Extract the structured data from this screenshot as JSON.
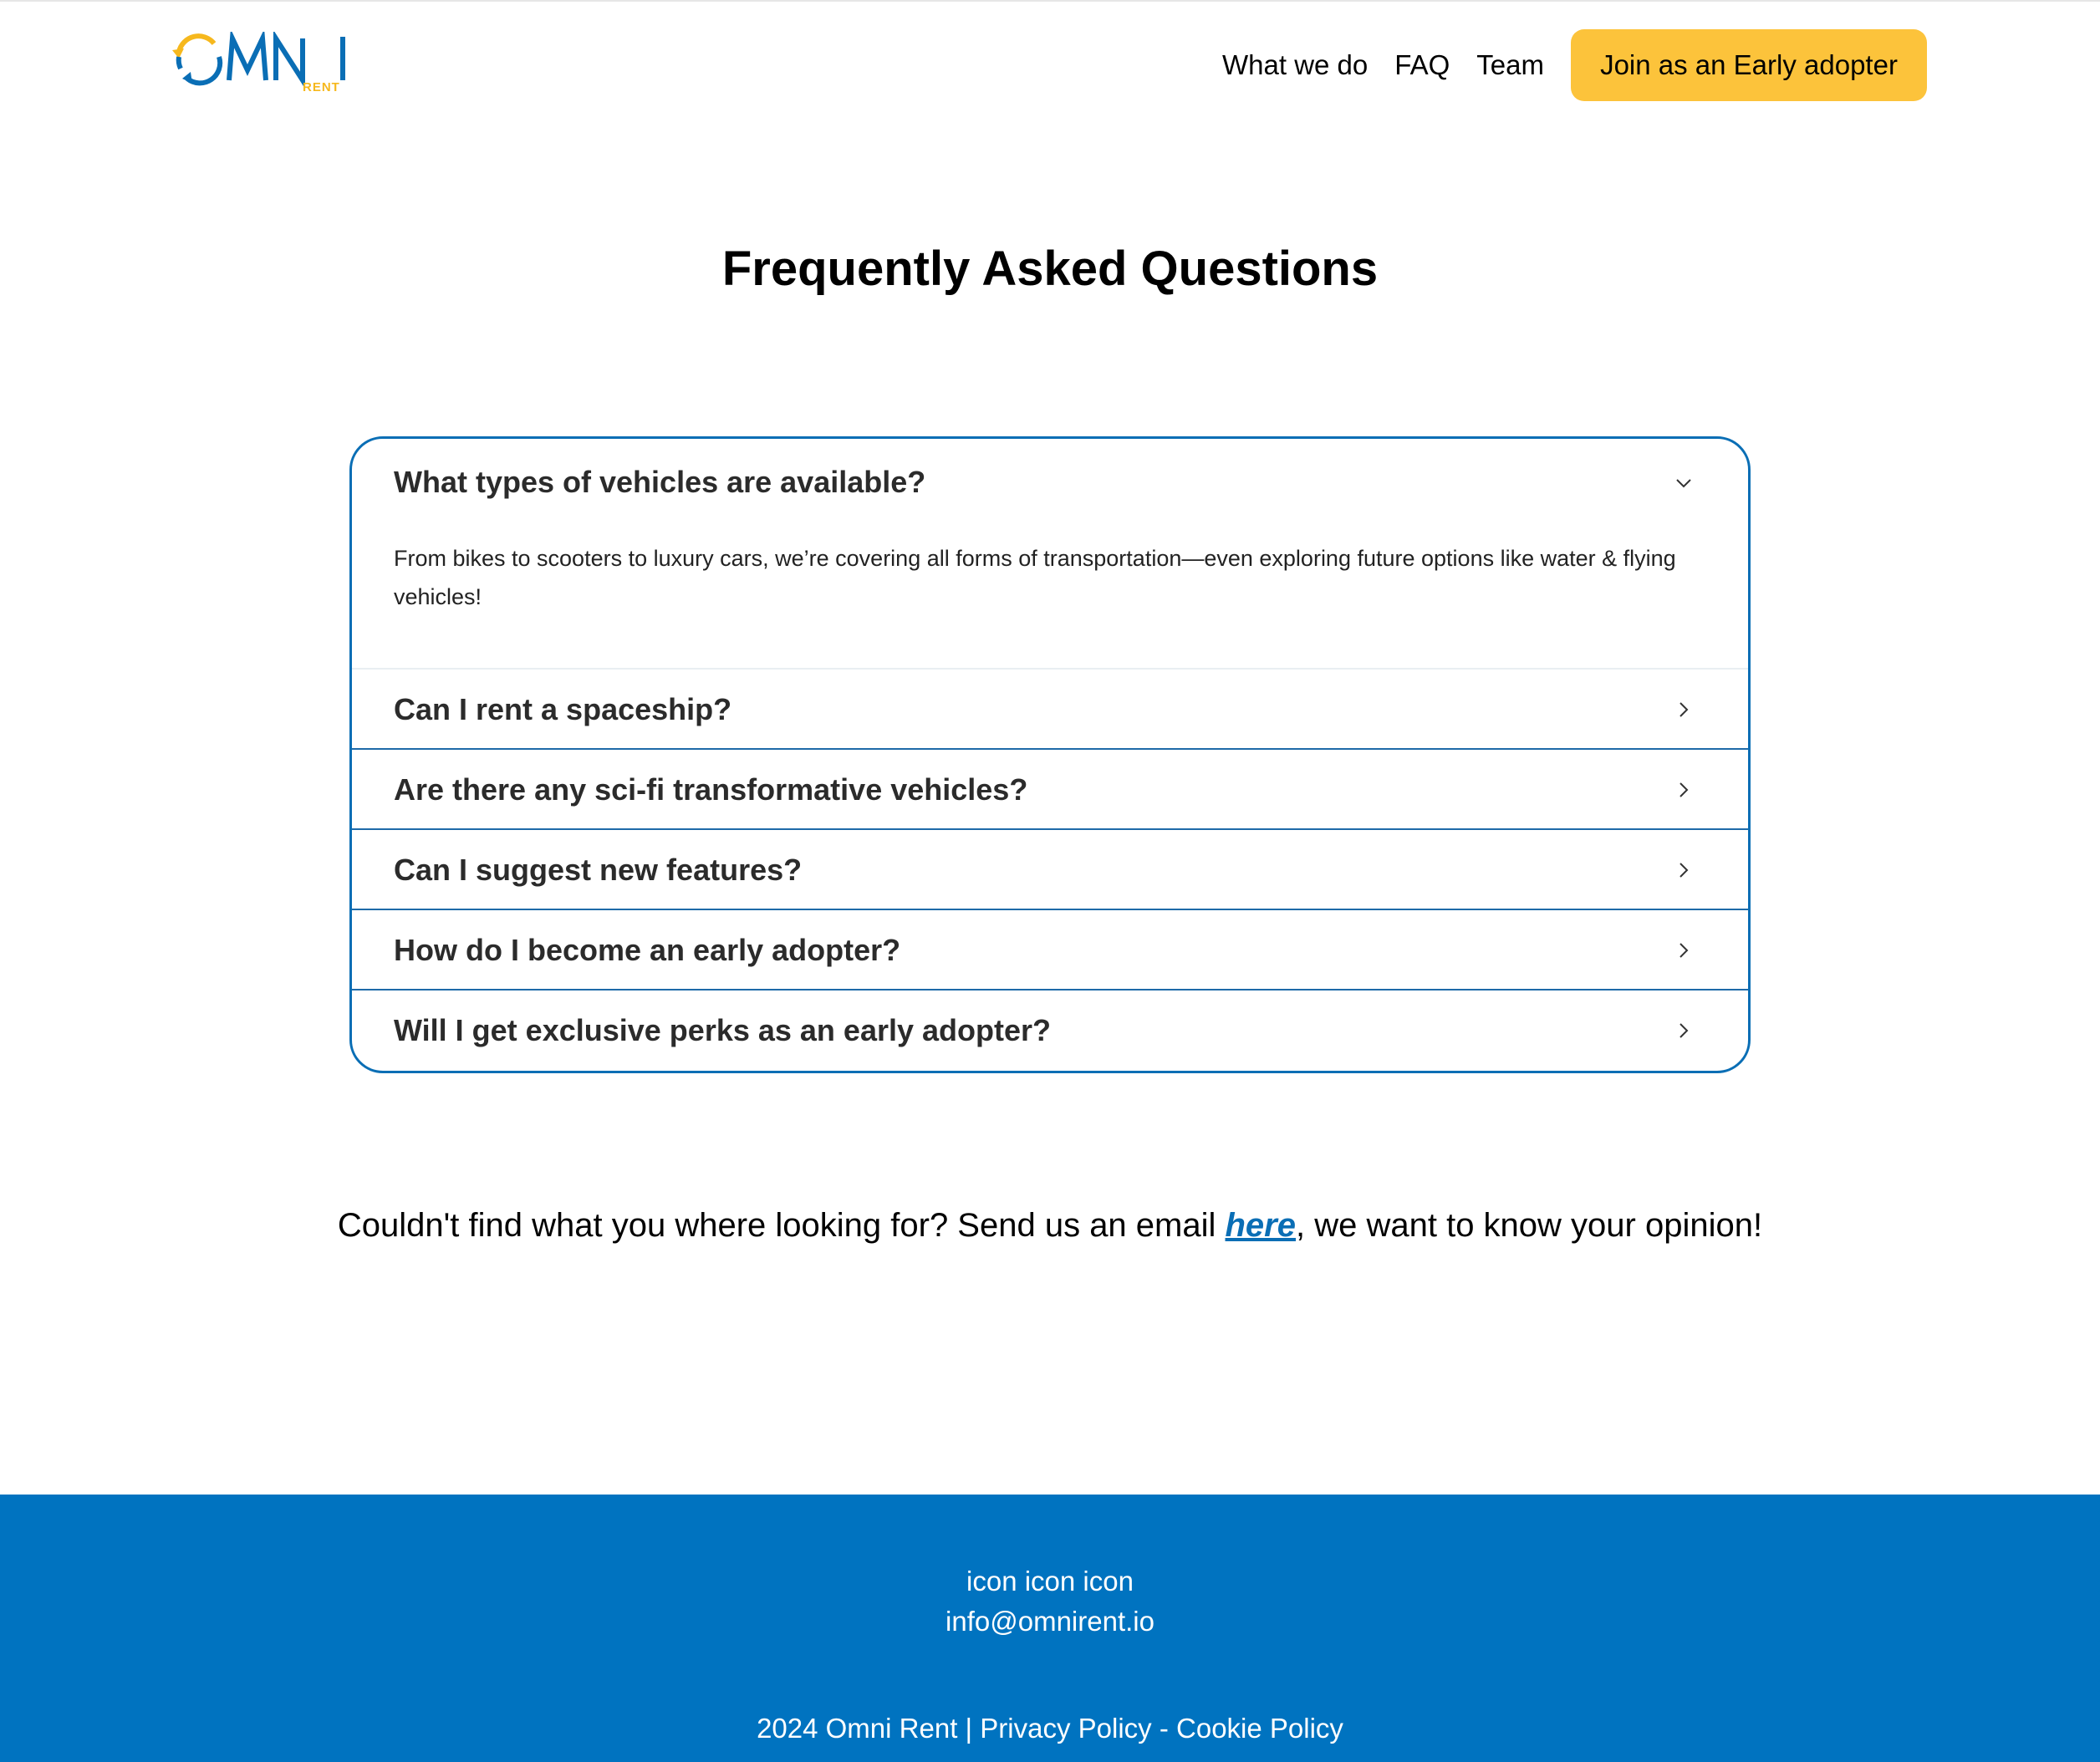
{
  "brand": {
    "logo_text": "OMNI",
    "logo_subtext": "RENT",
    "colors": {
      "primary_blue": "#0073c0",
      "accent_yellow": "#fcc33b",
      "logo_blue": "#0a6eb5",
      "logo_yellow": "#f6b81d"
    }
  },
  "nav": {
    "links": [
      {
        "label": "What we do"
      },
      {
        "label": "FAQ"
      },
      {
        "label": "Team"
      }
    ],
    "cta_label": "Join as an Early adopter"
  },
  "page": {
    "title": "Frequently Asked Questions"
  },
  "faq": {
    "items": [
      {
        "question": "What types of vehicles are available?",
        "answer": "From bikes to scooters to luxury cars, we’re covering all forms of transportation—even exploring future options like water & flying vehicles!",
        "expanded": true,
        "icon": "chevron-down-icon"
      },
      {
        "question": "Can I rent a spaceship?",
        "expanded": false,
        "icon": "chevron-right-icon"
      },
      {
        "question": "Are there any sci-fi transformative vehicles?",
        "expanded": false,
        "icon": "chevron-right-icon"
      },
      {
        "question": "Can I suggest new features?",
        "expanded": false,
        "icon": "chevron-right-icon"
      },
      {
        "question": "How do I become an early adopter?",
        "expanded": false,
        "icon": "chevron-right-icon"
      },
      {
        "question": "Will I get exclusive perks as an early adopter?",
        "expanded": false,
        "icon": "chevron-right-icon"
      }
    ]
  },
  "contact": {
    "prefix": "Couldn't find what you where looking for? Send us an email ",
    "link_label": "here",
    "suffix": ", we want to know your opinion!"
  },
  "footer": {
    "icons_text": "icon icon icon",
    "email": "info@omnirent.io",
    "copyright": "2024 Omni Rent",
    "separator": " | ",
    "privacy_label": "Privacy Policy",
    "dash": " - ",
    "cookie_label": "Cookie Policy"
  }
}
